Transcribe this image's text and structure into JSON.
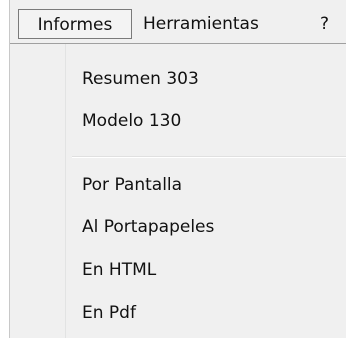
{
  "menubar": {
    "items": [
      {
        "label": "Informes",
        "state": "open"
      },
      {
        "label": "Herramientas"
      },
      {
        "label": "?"
      }
    ]
  },
  "dropdown": {
    "items": [
      {
        "label": "Resumen 303"
      },
      {
        "label": "Modelo 130"
      },
      {
        "label": "Por Pantalla"
      },
      {
        "label": "Al Portapapeles"
      },
      {
        "label": "En HTML"
      },
      {
        "label": "En Pdf"
      }
    ]
  },
  "colors": {
    "menu_background": "#f0f0f0",
    "open_item_border": "#7a7a7a",
    "text": "#111111"
  }
}
